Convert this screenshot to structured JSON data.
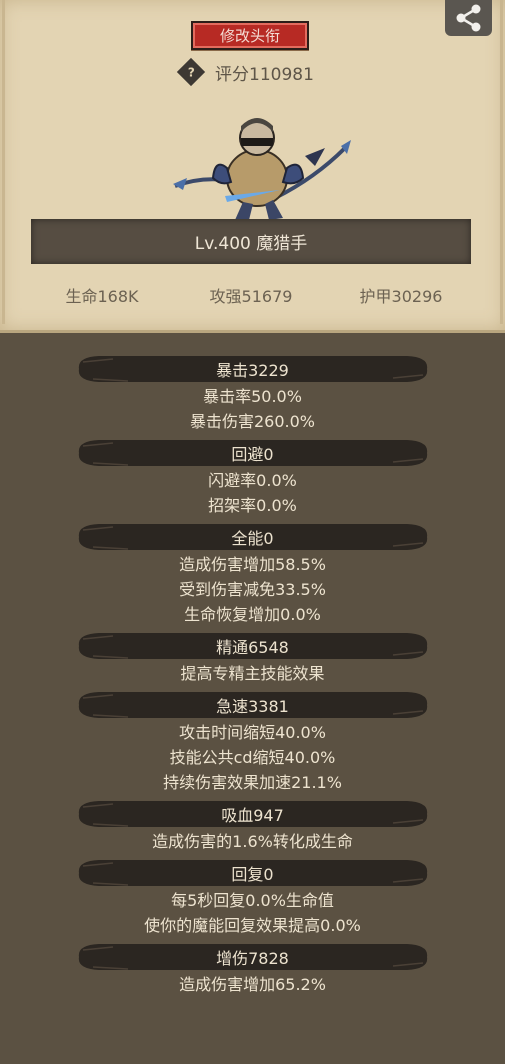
{
  "header": {
    "rename_label": "修改头衔",
    "score_text": "评分110981",
    "help_icon": "question-diamond-icon",
    "share_icon": "share-icon"
  },
  "hero": {
    "name": "Lv.400 魔猎手"
  },
  "base_stats": {
    "hp": "生命168K",
    "attack": "攻强51679",
    "armor": "护甲30296"
  },
  "groups": [
    {
      "title": "暴击3229",
      "lines": [
        "暴击率50.0%",
        "暴击伤害260.0%"
      ]
    },
    {
      "title": "回避0",
      "lines": [
        "闪避率0.0%",
        "招架率0.0%"
      ]
    },
    {
      "title": "全能0",
      "lines": [
        "造成伤害增加58.5%",
        "受到伤害减免33.5%",
        "生命恢复增加0.0%"
      ]
    },
    {
      "title": "精通6548",
      "lines": [
        "提高专精主技能效果"
      ]
    },
    {
      "title": "急速3381",
      "lines": [
        "攻击时间缩短40.0%",
        "技能公共cd缩短40.0%",
        "持续伤害效果加速21.1%"
      ]
    },
    {
      "title": "吸血947",
      "lines": [
        "造成伤害的1.6%转化成生命"
      ]
    },
    {
      "title": "回复0",
      "lines": [
        "每5秒回复0.0%生命值",
        "使你的魔能回复效果提高0.0%"
      ]
    },
    {
      "title": "增伤7828",
      "lines": [
        "造成伤害增加65.2%"
      ]
    }
  ],
  "colors": {
    "panel_bg": "#e3d4b3",
    "page_bg": "#5b5142",
    "button_red": "#b72a24",
    "banner_dark": "#2b2621"
  }
}
